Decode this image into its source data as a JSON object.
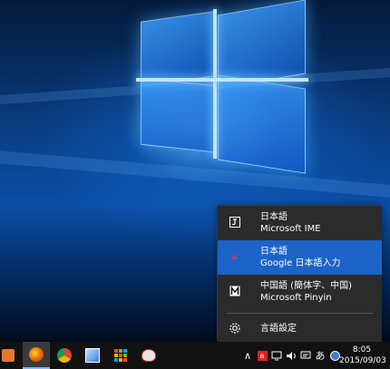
{
  "menu": {
    "items": [
      {
        "name": "日本語",
        "ime": "Microsoft IME",
        "icon": "microsoft-ime-icon"
      },
      {
        "name": "日本語",
        "ime": "Google 日本語入力",
        "icon": "google-japanese-input-icon"
      },
      {
        "name": "中国語 (簡体字、中国)",
        "ime": "Microsoft Pinyin",
        "icon": "microsoft-pinyin-icon"
      }
    ],
    "settings_label": "言語設定",
    "selected_index": 1
  },
  "taskbar": {
    "apps": [
      "media-player-icon",
      "firefox-icon",
      "chrome-icon",
      "image-app-icon",
      "apps-grid-icon",
      "game-app-icon"
    ],
    "tray": {
      "ime_mode": "あ"
    },
    "clock": {
      "time": "8:05",
      "date": "2015/09/03"
    }
  },
  "colors": {
    "menu_bg": "#2b2b2b",
    "selected": "#1c63c7",
    "taskbar_bg": "#111111"
  }
}
